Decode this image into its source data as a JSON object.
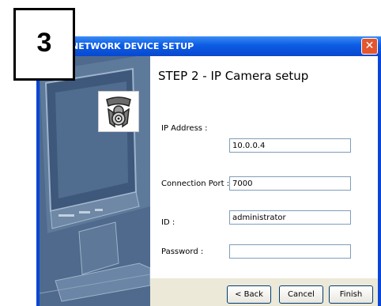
{
  "step_badge": "3",
  "window": {
    "title": "NETWORK DEVICE SETUP",
    "close_glyph": "✕"
  },
  "panel": {
    "camera_icon": "ip-camera-icon"
  },
  "content": {
    "step_title": "STEP 2 -  IP Camera setup",
    "ip_label": "IP Address :",
    "ip_value": "10.0.0.4",
    "port_label": "Connection Port :",
    "port_value": "7000",
    "id_label": "ID :",
    "id_value": "administrator",
    "password_label": "Password :",
    "password_value": ""
  },
  "buttons": {
    "back": "< Back",
    "cancel": "Cancel",
    "finish": "Finish"
  }
}
